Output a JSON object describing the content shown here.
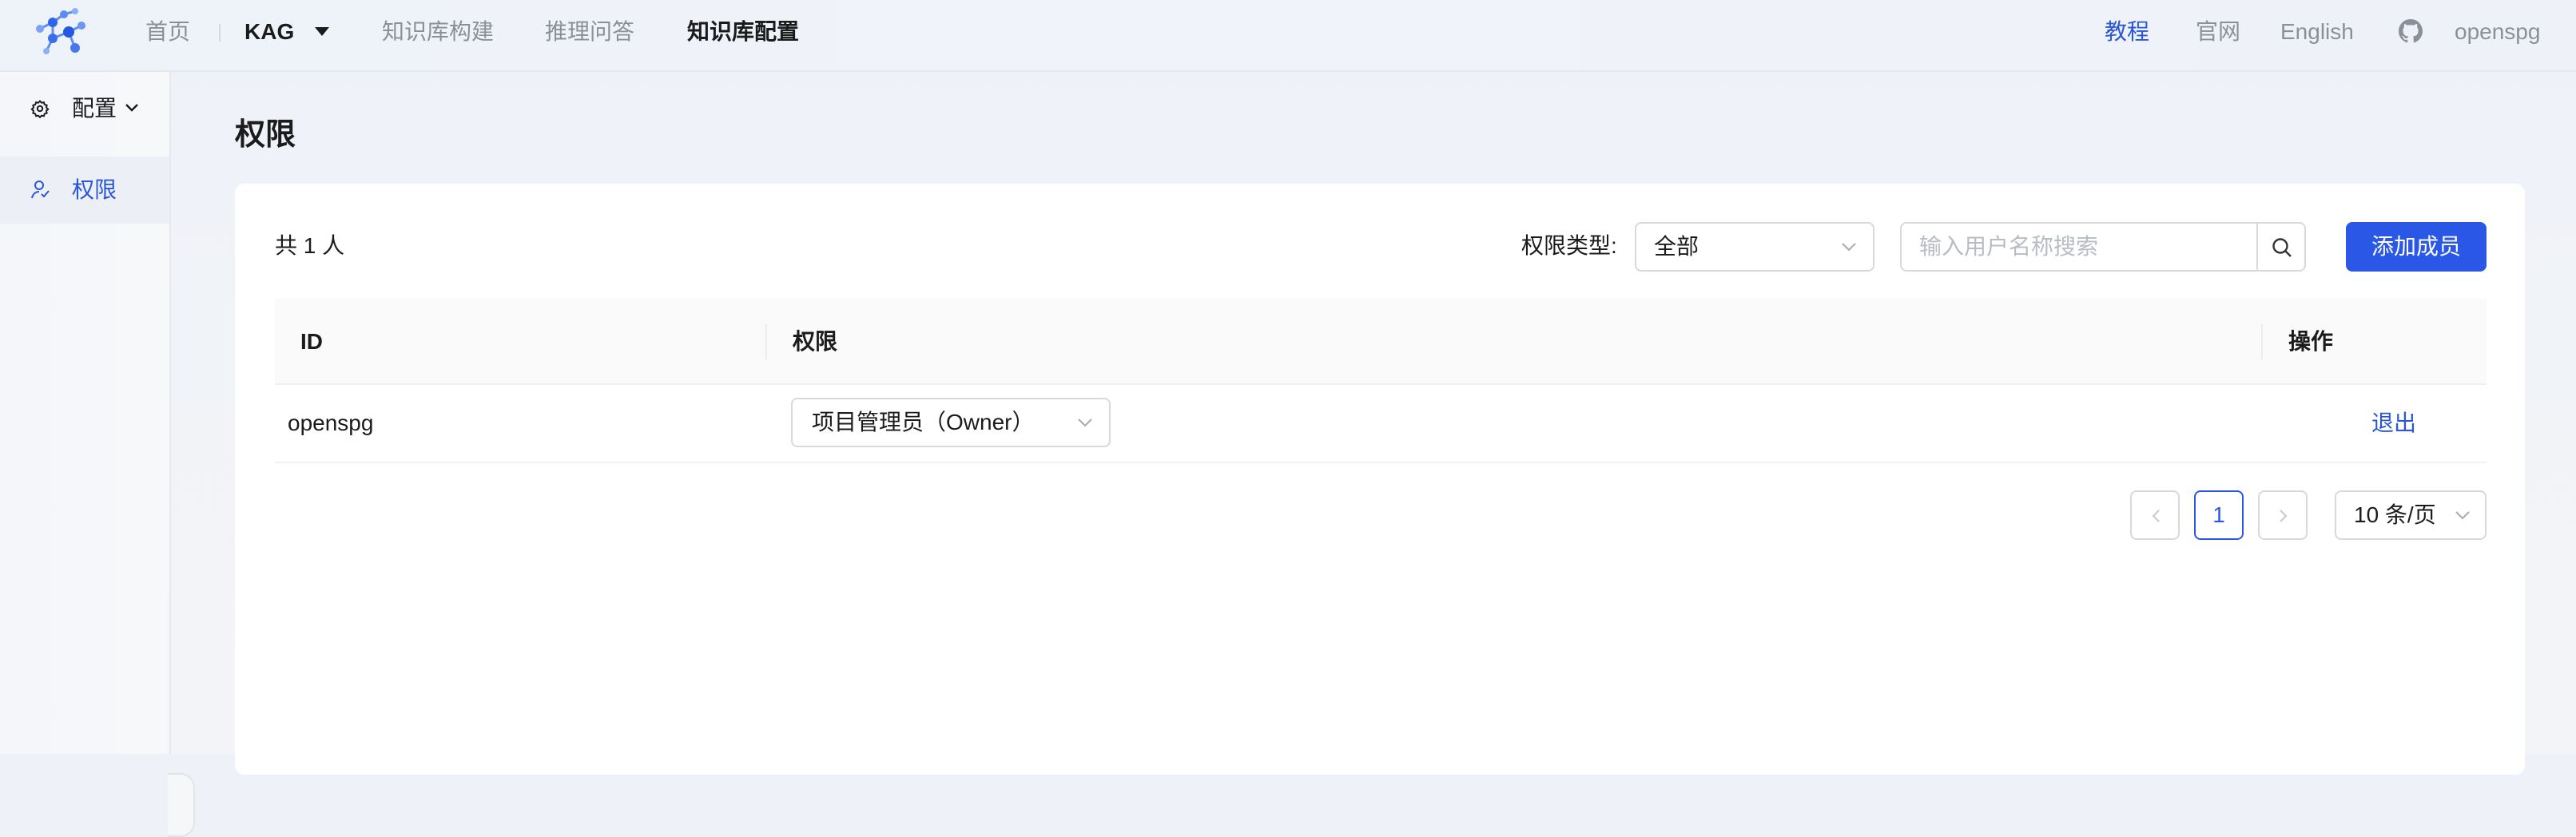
{
  "topnav": {
    "items": [
      {
        "label": "首页"
      },
      {
        "label": "知识库构建"
      },
      {
        "label": "推理问答"
      },
      {
        "label": "知识库配置"
      }
    ],
    "project": {
      "label": "KAG"
    },
    "right": {
      "tutorial": "教程",
      "official_site": "官网",
      "language": "English",
      "github_icon": "github-icon",
      "user": "openspg"
    }
  },
  "sidebar": {
    "section": {
      "label": "配置",
      "icon": "gear-icon"
    },
    "items": [
      {
        "label": "权限",
        "icon": "user-permission-icon",
        "active": true
      }
    ]
  },
  "main": {
    "title": "权限",
    "total_text": "共 1 人",
    "filter": {
      "label": "权限类型:",
      "value": "全部"
    },
    "search": {
      "placeholder": "输入用户名称搜索",
      "value": ""
    },
    "add_button": "添加成员",
    "table": {
      "headers": {
        "id": "ID",
        "permission": "权限",
        "action": "操作"
      },
      "rows": [
        {
          "id": "openspg",
          "permission": "项目管理员（Owner）",
          "action": "退出"
        }
      ]
    },
    "pagination": {
      "current_page": "1",
      "page_size": "10 条/页"
    }
  },
  "colors": {
    "primary": "#2a57e6",
    "link": "#2a57d8",
    "muted_text": "#8a8f99"
  }
}
